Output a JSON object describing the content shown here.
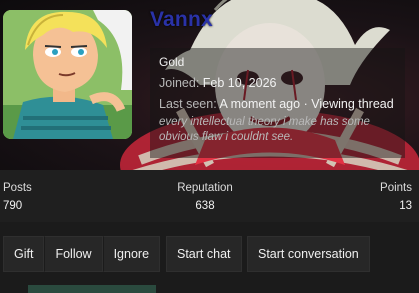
{
  "profile": {
    "username": "Vannx",
    "user_title": "Gold",
    "joined_label": "Joined:",
    "joined_value": "Feb 10, 2026",
    "last_seen_label": "Last seen:",
    "last_seen_value": "A moment ago",
    "last_seen_separator": "·",
    "last_seen_activity": "Viewing thread",
    "signature": "every intellectual theory i make has some obvious flaw i couldnt see."
  },
  "stats": {
    "posts_label": "Posts",
    "posts_value": "790",
    "reputation_label": "Reputation",
    "reputation_value": "638",
    "points_label": "Points",
    "points_value": "13"
  },
  "actions": {
    "gift": "Gift",
    "follow": "Follow",
    "ignore": "Ignore",
    "start_chat": "Start chat",
    "start_conversation": "Start conversation"
  },
  "colors": {
    "username": "#2a32a8",
    "page_background": "#1b1b1b",
    "button_background": "#272727"
  }
}
